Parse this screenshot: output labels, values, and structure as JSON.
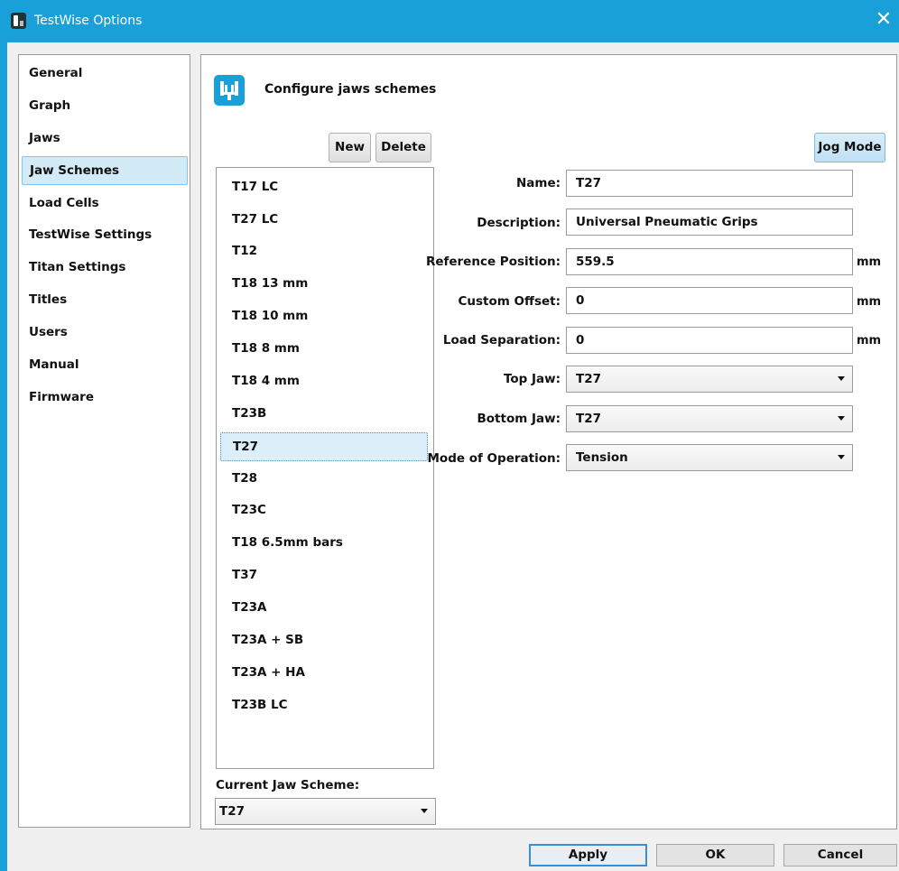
{
  "window": {
    "title": "TestWise Options",
    "accent": "#1aa0d8"
  },
  "nav": {
    "items": [
      {
        "label": "General"
      },
      {
        "label": "Graph"
      },
      {
        "label": "Jaws"
      },
      {
        "label": "Jaw Schemes",
        "selected": true
      },
      {
        "label": "Load Cells"
      },
      {
        "label": "TestWise Settings"
      },
      {
        "label": "Titan Settings"
      },
      {
        "label": "Titles"
      },
      {
        "label": "Users"
      },
      {
        "label": "Manual"
      },
      {
        "label": "Firmware"
      }
    ]
  },
  "main": {
    "header_title": "Configure jaws schemes",
    "toolbar": {
      "new_label": "New",
      "delete_label": "Delete",
      "jog_label": "Jog Mode"
    },
    "schemes": [
      "T17 LC",
      "T27 LC",
      "T12",
      "T18 13 mm",
      "T18 10 mm",
      "T18 8 mm",
      "T18 4 mm",
      "T23B",
      "T27",
      "T28",
      "T23C",
      "T18 6.5mm bars",
      "T37",
      "T23A",
      "T23A + SB",
      "T23A  + HA",
      "T23B LC"
    ],
    "selected_scheme": "T27",
    "current_jaw_scheme_label": "Current Jaw Scheme:",
    "current_jaw_scheme_value": "T27",
    "form": {
      "name_label": "Name:",
      "name_value": "T27",
      "description_label": "Description:",
      "description_value": "Universal Pneumatic Grips",
      "reference_label": "Reference Position:",
      "reference_value": "559.5",
      "custom_offset_label": "Custom Offset:",
      "custom_offset_value": "0",
      "load_separation_label": "Load Separation:",
      "load_separation_value": "0",
      "top_jaw_label": "Top Jaw:",
      "top_jaw_value": "T27",
      "bottom_jaw_label": "Bottom Jaw:",
      "bottom_jaw_value": "T27",
      "mode_label": "Mode of Operation:",
      "mode_value": "Tension",
      "unit": "mm"
    }
  },
  "footer": {
    "apply_label": "Apply",
    "ok_label": "OK",
    "cancel_label": "Cancel"
  }
}
